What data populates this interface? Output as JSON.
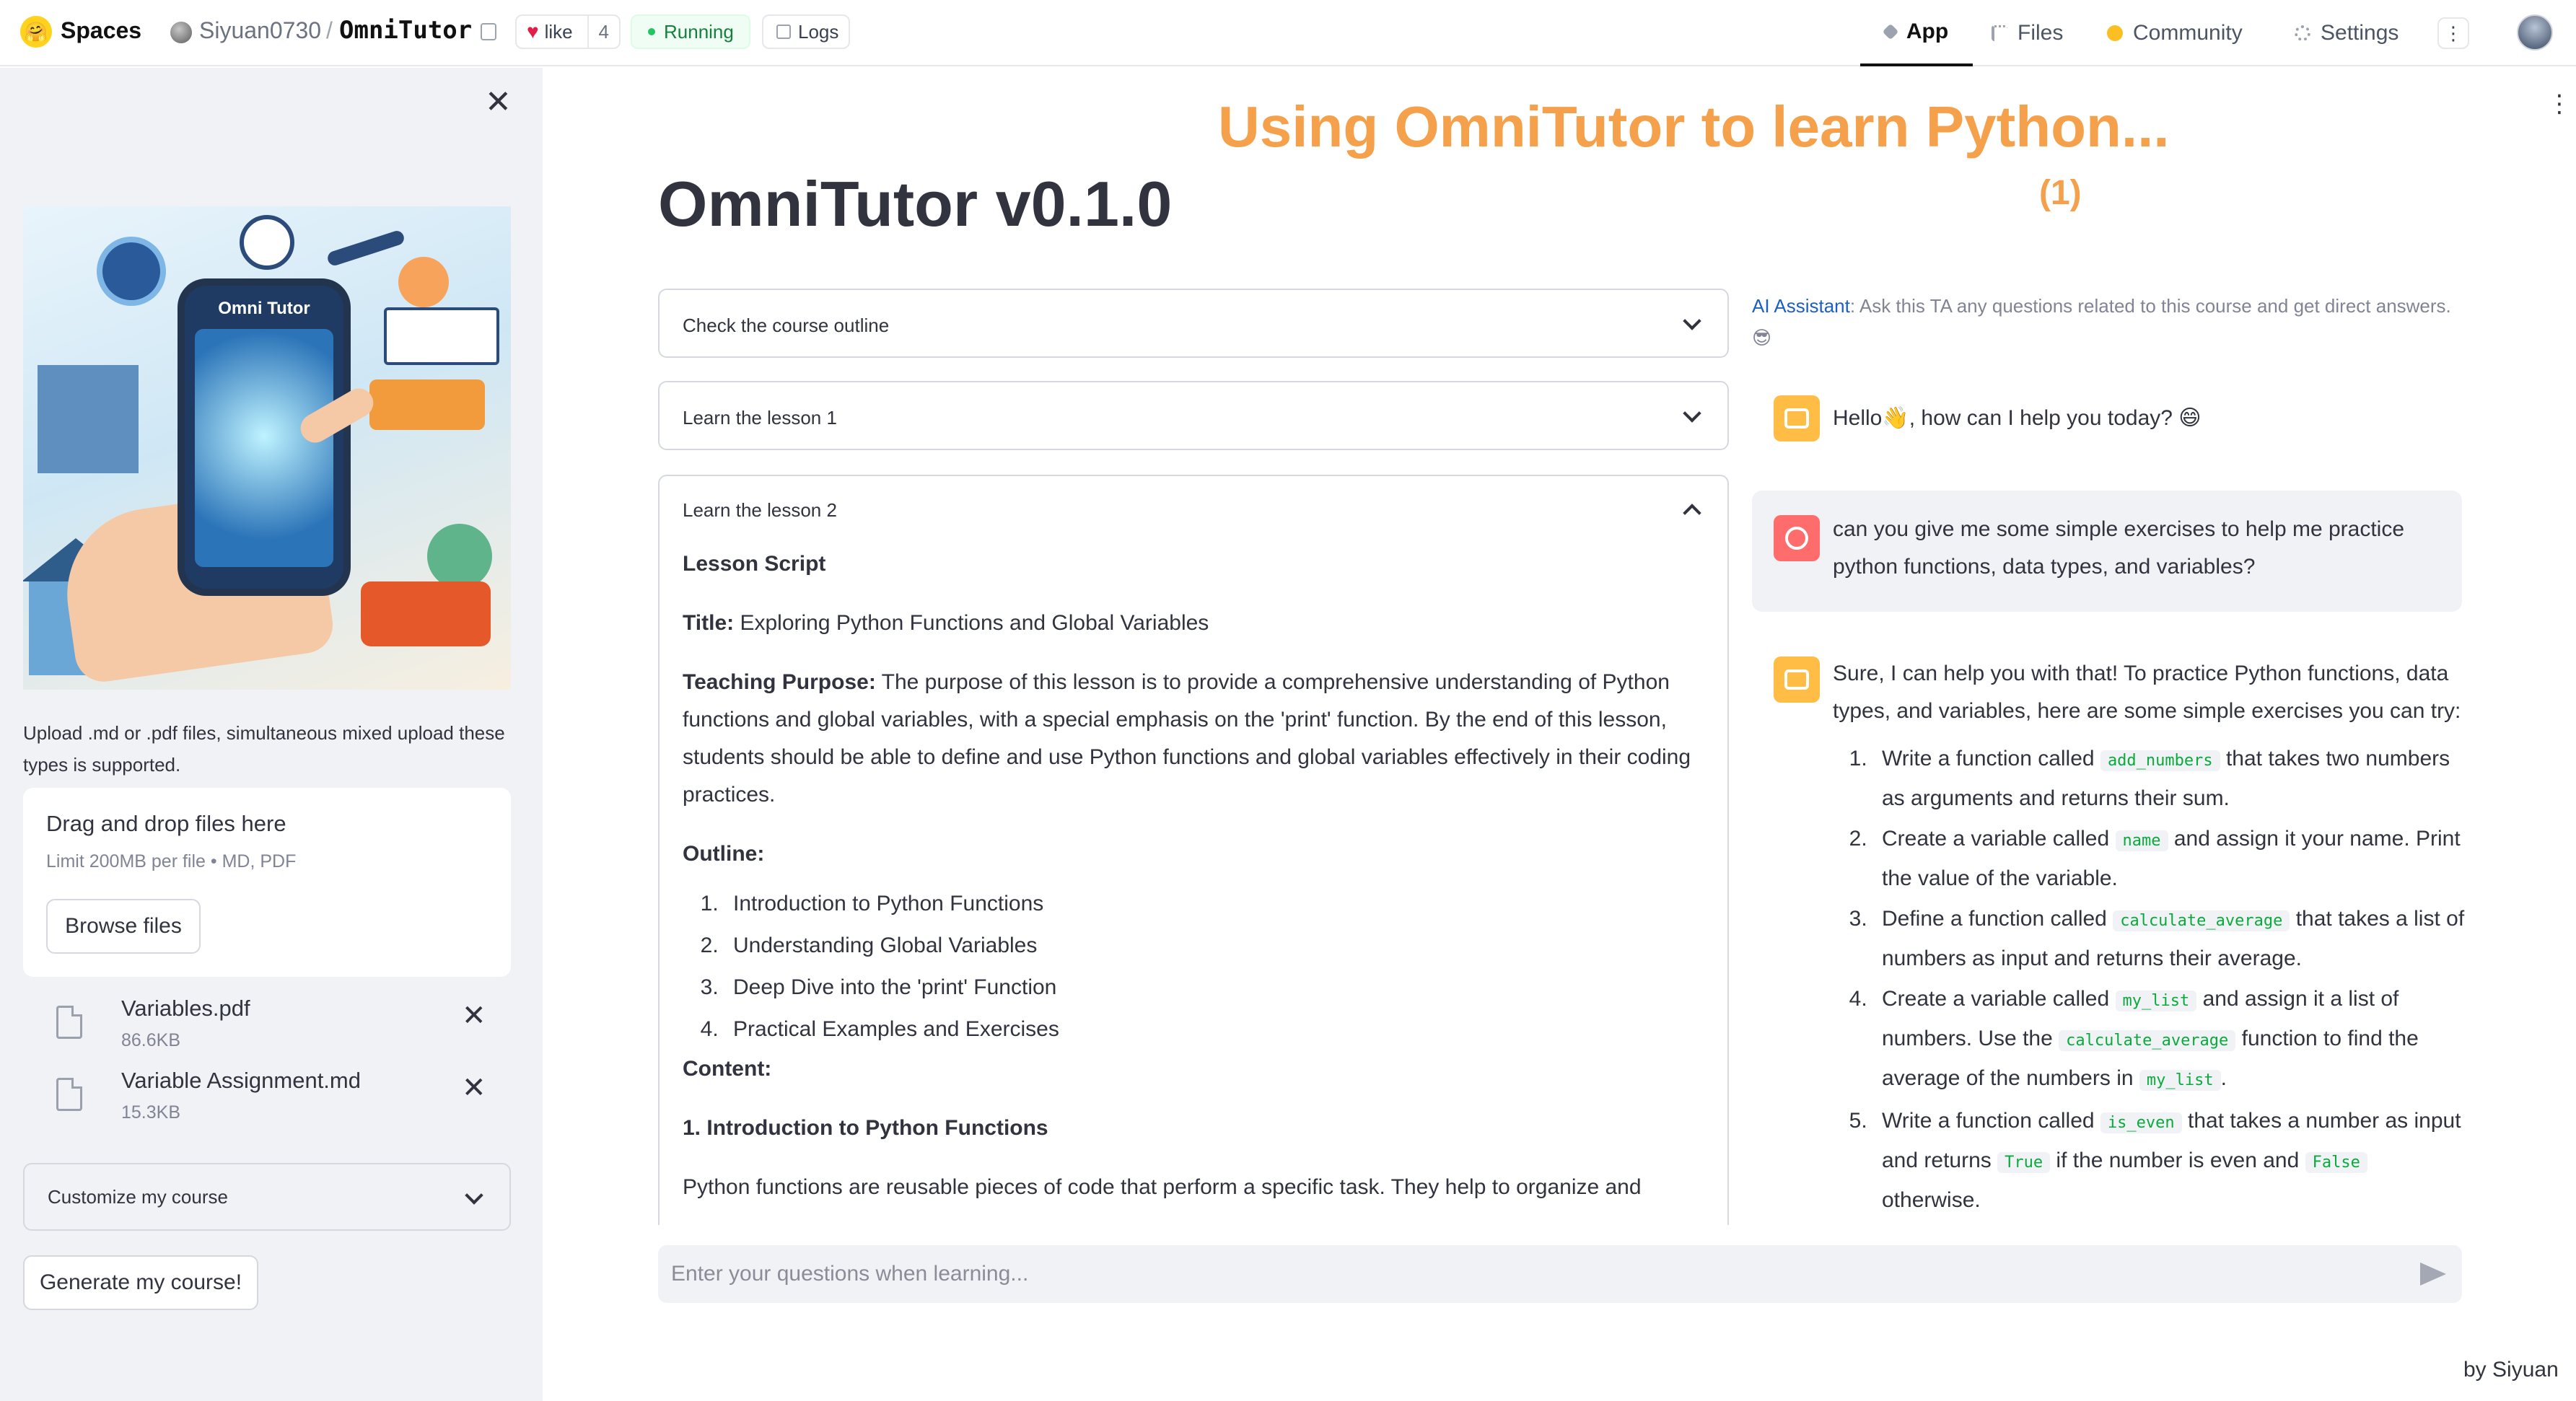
{
  "topbar": {
    "spaces_label": "Spaces",
    "owner": "Siyuan0730",
    "separator": "/",
    "repo": "OmniTutor",
    "like_label": "like",
    "like_count": "4",
    "status": "Running",
    "logs_label": "Logs",
    "tabs": [
      {
        "label": "App",
        "active": true,
        "icon": "app-icon"
      },
      {
        "label": "Files",
        "active": false,
        "icon": "files-icon"
      },
      {
        "label": "Community",
        "active": false,
        "icon": "community-icon"
      },
      {
        "label": "Settings",
        "active": false,
        "icon": "settings-icon"
      }
    ],
    "more_glyph": "⋮"
  },
  "sidebar": {
    "close_glyph": "✕",
    "hero_text": "Omni Tutor",
    "upload_hint": "Upload .md or .pdf files, simultaneous mixed upload these types is supported.",
    "dropzone": {
      "title": "Drag and drop files here",
      "limit": "Limit 200MB per file • MD, PDF",
      "browse_label": "Browse files"
    },
    "files": [
      {
        "name": "Variables.pdf",
        "size": "86.6KB"
      },
      {
        "name": "Variable Assignment.md",
        "size": "15.3KB"
      }
    ],
    "remove_glyph": "✕",
    "customize_label": "Customize my course",
    "generate_label": "Generate my course!"
  },
  "main": {
    "overlay_title": "Using OmniTutor to learn Python...",
    "overlay_number": "(1)",
    "more_glyph": "⋮",
    "page_title": "OmniTutor v0.1.0",
    "expanders": [
      {
        "label": "Check the course outline",
        "open": false
      },
      {
        "label": "Learn the lesson 1",
        "open": false
      },
      {
        "label": "Learn the lesson 2",
        "open": true
      }
    ],
    "lesson": {
      "script_heading": "Lesson Script",
      "title_label": "Title:",
      "title_value": "Exploring Python Functions and Global Variables",
      "purpose_label": "Teaching Purpose:",
      "purpose_text": "The purpose of this lesson is to provide a comprehensive understanding of Python functions and global variables, with a special emphasis on the 'print' function. By the end of this lesson, students should be able to define and use Python functions and global variables effectively in their coding practices.",
      "outline_label": "Outline:",
      "outline_items": [
        "Introduction to Python Functions",
        "Understanding Global Variables",
        "Deep Dive into the 'print' Function",
        "Practical Examples and Exercises"
      ],
      "content_label": "Content:",
      "section1_heading": "1. Introduction to Python Functions",
      "section1_text": "Python functions are reusable pieces of code that perform a specific task. They help to organize and"
    }
  },
  "assistant": {
    "note_link": "AI Assistant",
    "note_text": ": Ask this TA any questions related to this course and get direct answers. 😎",
    "greeting": "Hello👋, how can I help you today? 😄",
    "user_question": "can you give me some simple exercises to help me practice python functions, data types, and variables?",
    "answer_intro": "Sure, I can help you with that! To practice Python functions, data types, and variables, here are some simple exercises you can try:",
    "answer_items": [
      {
        "a": "Write a function called ",
        "c1": "add_numbers",
        "b": " that takes two numbers as arguments and returns their sum."
      },
      {
        "a": "Create a variable called ",
        "c1": "name",
        "b": " and assign it your name. Print the value of the variable."
      },
      {
        "a": "Define a function called ",
        "c1": "calculate_average",
        "b": " that takes a list of numbers as input and returns their average."
      },
      {
        "a": "Create a variable called ",
        "c1": "my_list",
        "b": " and assign it a list of numbers. Use the ",
        "c2": "calculate_average",
        "d": " function to find the average of the numbers in ",
        "c3": "my_list",
        "e": "."
      },
      {
        "a": "Write a function called ",
        "c1": "is_even",
        "b": " that takes a number as input and returns ",
        "c2": "True",
        "d": " if the number is even and ",
        "c3": "False",
        "e": " otherwise."
      }
    ],
    "input_placeholder": "Enter your questions when learning...",
    "footer": "by Siyuan"
  }
}
